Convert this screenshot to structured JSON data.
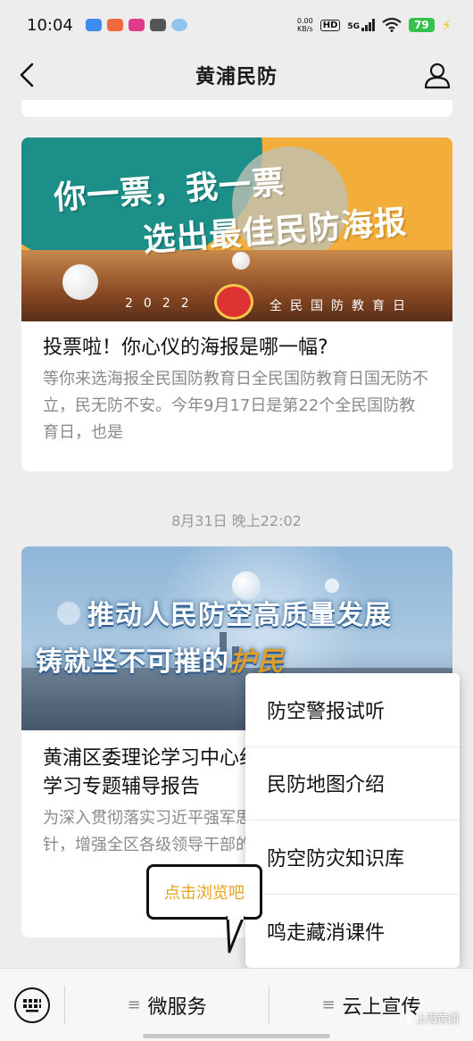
{
  "status_bar": {
    "time": "10:04",
    "net_speed_value": "0.00",
    "net_speed_unit": "KB/s",
    "hd": "HD",
    "signal": "5G",
    "battery": "79"
  },
  "nav": {
    "title": "黄浦民防"
  },
  "articles": [
    {
      "banner_line1": "你一票，我一票",
      "banner_line2": "选出最佳民防海报",
      "banner_year": "2022",
      "banner_event": "全民国防教育日",
      "title": "投票啦！你心仪的海报是哪一幅?",
      "description": "等你来选海报全民国防教育日全民国防教育日国无防不立，民无防不安。今年9月17日是第22个全民国防教育日，也是"
    },
    {
      "banner_line1": "推动人民防空高质量发展",
      "banner_line2_prefix": "铸就坚不可摧的",
      "banner_line2_suffix": "护民",
      "title": "黄浦区委理论学习中心组人民防空工作举行学习专题辅导报告",
      "description": "为深入贯彻落实习近平强军思想和新时代军事战略方针，增强全区各级领导干部的责任感、使命感和紧迫感"
    }
  ],
  "date_separator": "8月31日 晚上22:02",
  "menu": {
    "items": [
      "防空警报试听",
      "民防地图介绍",
      "防空防灾知识库",
      "鸣走藏消课件"
    ]
  },
  "tooltip": "点击浏览吧",
  "bottom_bar": {
    "tabs": [
      "微服务",
      "云上宣传"
    ]
  },
  "watermark": "上海黄浦",
  "colors": {
    "battery": "#36c24a",
    "tooltip_text": "#e8a21a",
    "page_bg": "#ededed"
  },
  "icons": [
    "back-arrow-icon",
    "user-profile-icon",
    "keyboard-icon",
    "menu-lines-icon",
    "wechat-icon"
  ]
}
